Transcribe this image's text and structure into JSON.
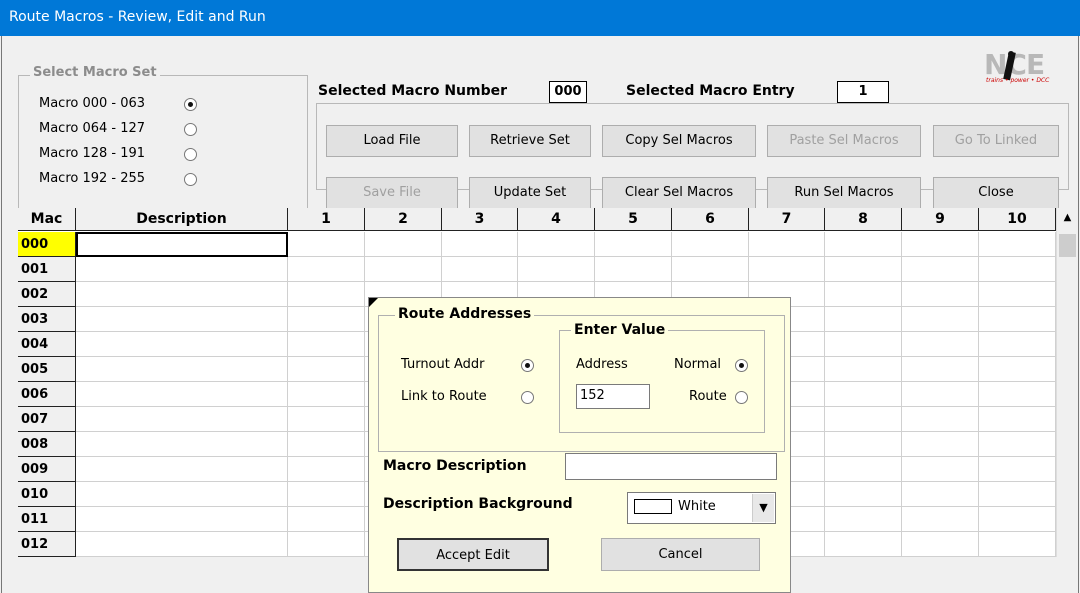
{
  "window": {
    "title": "Route Macros - Review, Edit and Run"
  },
  "macro_set": {
    "legend": "Select Macro Set",
    "options": [
      {
        "label": "Macro 000 - 063",
        "selected": true
      },
      {
        "label": "Macro 064 - 127",
        "selected": false
      },
      {
        "label": "Macro 128 - 191",
        "selected": false
      },
      {
        "label": "Macro 192 - 255",
        "selected": false
      }
    ]
  },
  "selected": {
    "macro_number_label": "Selected Macro Number",
    "macro_number": "000",
    "macro_entry_label": "Selected Macro Entry",
    "macro_entry": "1"
  },
  "logo": {
    "text": "NCE",
    "tagline": "trains • power • DCC"
  },
  "buttons": {
    "load_file": "Load File",
    "retrieve_set": "Retrieve Set",
    "copy_sel_macros": "Copy Sel Macros",
    "paste_sel_macros": "Paste Sel Macros",
    "go_to_linked": "Go To Linked",
    "save_file": "Save File",
    "update_set": "Update Set",
    "clear_sel_macros": "Clear Sel Macros",
    "run_sel_macros": "Run Sel Macros",
    "close": "Close"
  },
  "grid": {
    "columns": [
      "Mac",
      "Description",
      "1",
      "2",
      "3",
      "4",
      "5",
      "6",
      "7",
      "8",
      "9",
      "10"
    ],
    "rows": [
      "000",
      "001",
      "002",
      "003",
      "004",
      "005",
      "006",
      "007",
      "008",
      "009",
      "010",
      "011",
      "012"
    ],
    "selected_row": "000"
  },
  "popup": {
    "route_addresses_legend": "Route Addresses",
    "turnout_addr_label": "Turnout Addr",
    "turnout_addr_selected": true,
    "link_to_route_label": "Link to Route",
    "link_to_route_selected": false,
    "enter_value_legend": "Enter Value",
    "address_label": "Address",
    "address_value": "152",
    "normal_label": "Normal",
    "normal_selected": true,
    "route_label": "Route",
    "route_selected": false,
    "macro_description_label": "Macro Description",
    "macro_description_value": "",
    "description_background_label": "Description Background",
    "background_value": "White",
    "accept_edit": "Accept Edit",
    "cancel": "Cancel"
  },
  "colors": {
    "titlebar": "#0078d7",
    "selected_row_highlight": "#ffff00",
    "popup_background": "#ffffe1"
  }
}
